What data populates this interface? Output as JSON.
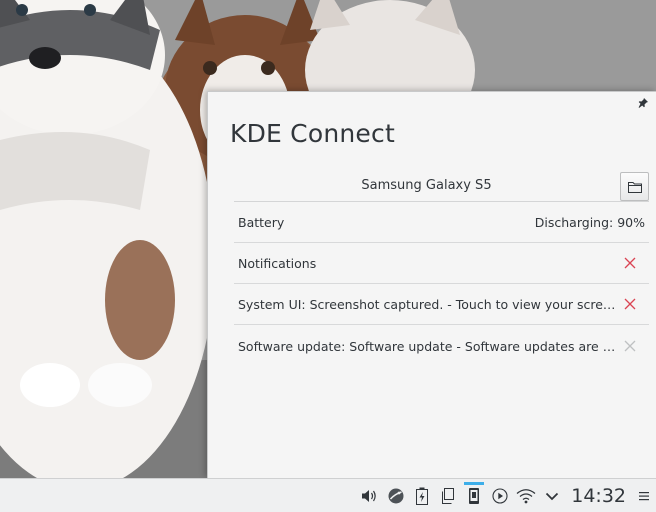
{
  "popup": {
    "title": "KDE Connect",
    "device_name": "Samsung Galaxy S5",
    "battery": {
      "label": "Battery",
      "value": "Discharging: 90%"
    },
    "notifications_header": "Notifications",
    "notifications": [
      {
        "text": "System UI: Screenshot captured. - Touch to view your screenshot.",
        "dismissable": true
      },
      {
        "text": "Software update: Software update - Software updates are availa...",
        "dismissable": false
      }
    ]
  },
  "panel": {
    "tray_icons": [
      "volume-icon",
      "network-manager-icon",
      "battery-icon",
      "clipboard-icon",
      "kdeconnect-icon",
      "media-play-icon",
      "wifi-icon",
      "expand-tray-icon"
    ],
    "active_icon": "kdeconnect-icon",
    "clock": "14:32"
  },
  "colors": {
    "accent": "#3daee9",
    "close_red": "#da4453",
    "close_gray": "#bfc1c2",
    "text": "#31363b"
  }
}
